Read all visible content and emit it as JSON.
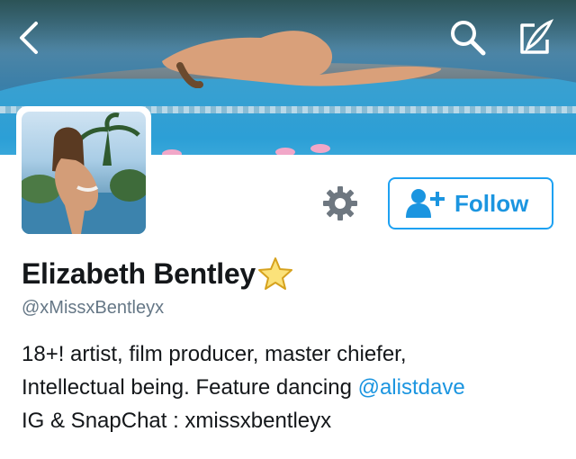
{
  "header": {
    "back_icon": "chevron-left-icon",
    "search_icon": "search-icon",
    "compose_icon": "compose-tweet-icon"
  },
  "profile": {
    "name": "Elizabeth Bentley",
    "badge_icon": "star-icon",
    "handle": "@xMissxBentleyx",
    "bio_line1": "18+! artist, film producer, master chiefer,",
    "bio_line2_prefix": "Intellectual being. Feature dancing",
    "bio_mention": "@alistdave",
    "bio_line3": "IG & SnapChat : xmissxbentleyx"
  },
  "actions": {
    "settings_icon": "gear-icon",
    "follow_icon": "add-user-icon",
    "follow_label": "Follow"
  },
  "colors": {
    "accent": "#1da1f2",
    "link": "#1b95e0",
    "text": "#14171a",
    "secondary_text": "#657786"
  }
}
